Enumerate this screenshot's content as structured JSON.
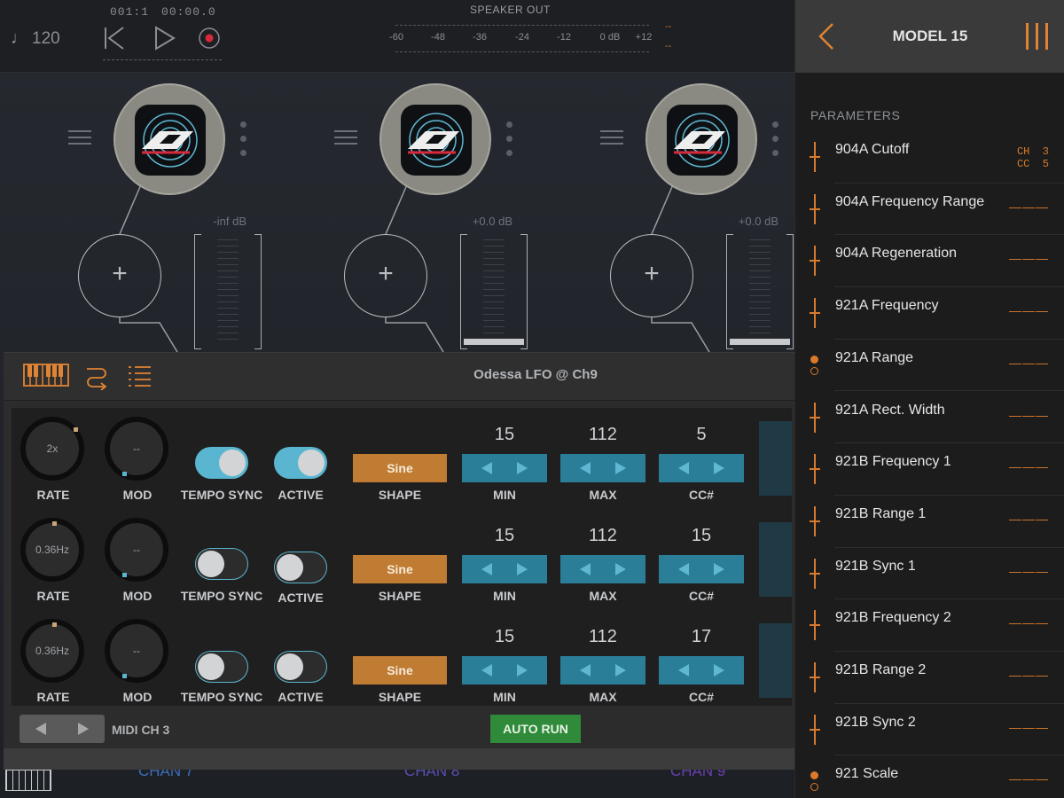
{
  "transport": {
    "tempo": "120",
    "position": "001:1",
    "time": "00:00.0"
  },
  "meter": {
    "title": "SPEAKER OUT",
    "ticks": [
      "-60",
      "-48",
      "-36",
      "-24",
      "-12",
      "0 dB",
      "+12"
    ],
    "peak_left": "--",
    "peak_right": "--"
  },
  "channels": [
    {
      "label": "CHAN 7",
      "level": "-inf dB",
      "color": "#3d6fb8"
    },
    {
      "label": "CHAN 8",
      "level": "+0.0 dB",
      "color": "#5a4fb0"
    },
    {
      "label": "CHAN 9",
      "level": "+0.0 dB",
      "color": "#6a3fb0"
    }
  ],
  "lfo": {
    "title": "Odessa LFO @ Ch9",
    "labels": {
      "rate": "RATE",
      "mod": "MOD",
      "tempo_sync": "TEMPO SYNC",
      "active": "ACTIVE",
      "shape": "SHAPE",
      "min": "MIN",
      "max": "MAX",
      "cc": "CC#"
    },
    "rows": [
      {
        "rate": "2x",
        "mod": "--",
        "tempo_sync": true,
        "active": true,
        "shape": "Sine",
        "min": "15",
        "max": "112",
        "cc": "5"
      },
      {
        "rate": "0.36Hz",
        "mod": "--",
        "tempo_sync": false,
        "active": false,
        "shape": "Sine",
        "min": "15",
        "max": "112",
        "cc": "15"
      },
      {
        "rate": "0.36Hz",
        "mod": "--",
        "tempo_sync": false,
        "active": false,
        "shape": "Sine",
        "min": "15",
        "max": "112",
        "cc": "17"
      }
    ],
    "midi_channel": "MIDI CH 3",
    "auto_run": "AUTO RUN"
  },
  "right_panel": {
    "title": "MODEL 15",
    "section": "PARAMETERS",
    "params": [
      {
        "name": "904A Cutoff",
        "value": "CH  3\nCC  5",
        "indicator": "line"
      },
      {
        "name": "904A Frequency Range",
        "value": "———",
        "indicator": "line"
      },
      {
        "name": "904A Regeneration",
        "value": "———",
        "indicator": "line"
      },
      {
        "name": "921A Frequency",
        "value": "———",
        "indicator": "line"
      },
      {
        "name": "921A Range",
        "value": "———",
        "indicator": "dots"
      },
      {
        "name": "921A Rect. Width",
        "value": "———",
        "indicator": "line"
      },
      {
        "name": "921B Frequency 1",
        "value": "———",
        "indicator": "line"
      },
      {
        "name": "921B Range 1",
        "value": "———",
        "indicator": "line"
      },
      {
        "name": "921B Sync 1",
        "value": "———",
        "indicator": "line"
      },
      {
        "name": "921B Frequency 2",
        "value": "———",
        "indicator": "line"
      },
      {
        "name": "921B Range 2",
        "value": "———",
        "indicator": "line"
      },
      {
        "name": "921B Sync 2",
        "value": "———",
        "indicator": "line"
      },
      {
        "name": "921 Scale",
        "value": "———",
        "indicator": "dots"
      }
    ]
  },
  "colors": {
    "accent": "#d97a2c",
    "toggle_on": "#5ab6d0",
    "stepper": "#2a7e98",
    "shape": "#c07c32",
    "auto_run": "#2f8a3a"
  },
  "icons": {
    "tempo": "quarter-note-icon",
    "rewind": "skip-back-icon",
    "play": "play-icon",
    "record": "record-icon",
    "keyboard": "keyboard-icon",
    "routing": "routing-icon",
    "list": "list-icon",
    "back": "chevron-left-icon",
    "menu": "vertical-bars-icon"
  }
}
